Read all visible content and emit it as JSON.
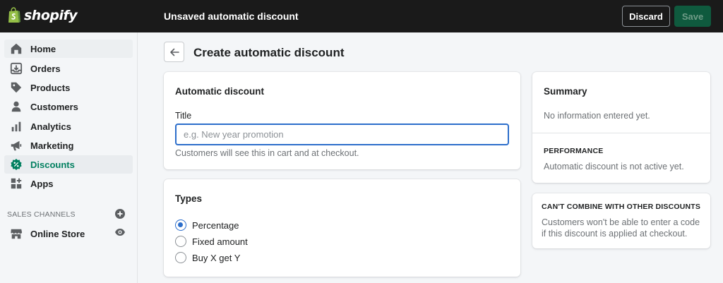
{
  "brand": {
    "name": "shopify"
  },
  "topbar": {
    "title": "Unsaved automatic discount",
    "discard_label": "Discard",
    "save_label": "Save"
  },
  "sidebar": {
    "items": [
      {
        "label": "Home",
        "icon": "home-icon"
      },
      {
        "label": "Orders",
        "icon": "orders-icon"
      },
      {
        "label": "Products",
        "icon": "tag-icon"
      },
      {
        "label": "Customers",
        "icon": "person-icon"
      },
      {
        "label": "Analytics",
        "icon": "bar-chart-icon"
      },
      {
        "label": "Marketing",
        "icon": "megaphone-icon"
      },
      {
        "label": "Discounts",
        "icon": "discount-icon",
        "active": true
      },
      {
        "label": "Apps",
        "icon": "apps-icon"
      }
    ],
    "sales_channels_label": "SALES CHANNELS",
    "channels": [
      {
        "label": "Online Store",
        "icon": "store-icon"
      }
    ]
  },
  "page": {
    "title": "Create automatic discount"
  },
  "automatic_discount": {
    "heading": "Automatic discount",
    "title_label": "Title",
    "title_value": "",
    "title_placeholder": "e.g. New year promotion",
    "help_text": "Customers will see this in cart and at checkout."
  },
  "types": {
    "heading": "Types",
    "options": [
      {
        "label": "Percentage",
        "selected": true
      },
      {
        "label": "Fixed amount",
        "selected": false
      },
      {
        "label": "Buy X get Y",
        "selected": false
      }
    ]
  },
  "summary": {
    "heading": "Summary",
    "empty_text": "No information entered yet.",
    "performance_label": "PERFORMANCE",
    "performance_text": "Automatic discount is not active yet."
  },
  "combine": {
    "heading": "CAN'T COMBINE WITH OTHER DISCOUNTS",
    "text": "Customers won't be able to enter a code if this discount is applied at checkout."
  },
  "colors": {
    "topbar_bg": "#1a1a1a",
    "save_bg": "#0f5a3e",
    "active_nav": "#007f5f",
    "focus_blue": "#2c6ecb"
  }
}
